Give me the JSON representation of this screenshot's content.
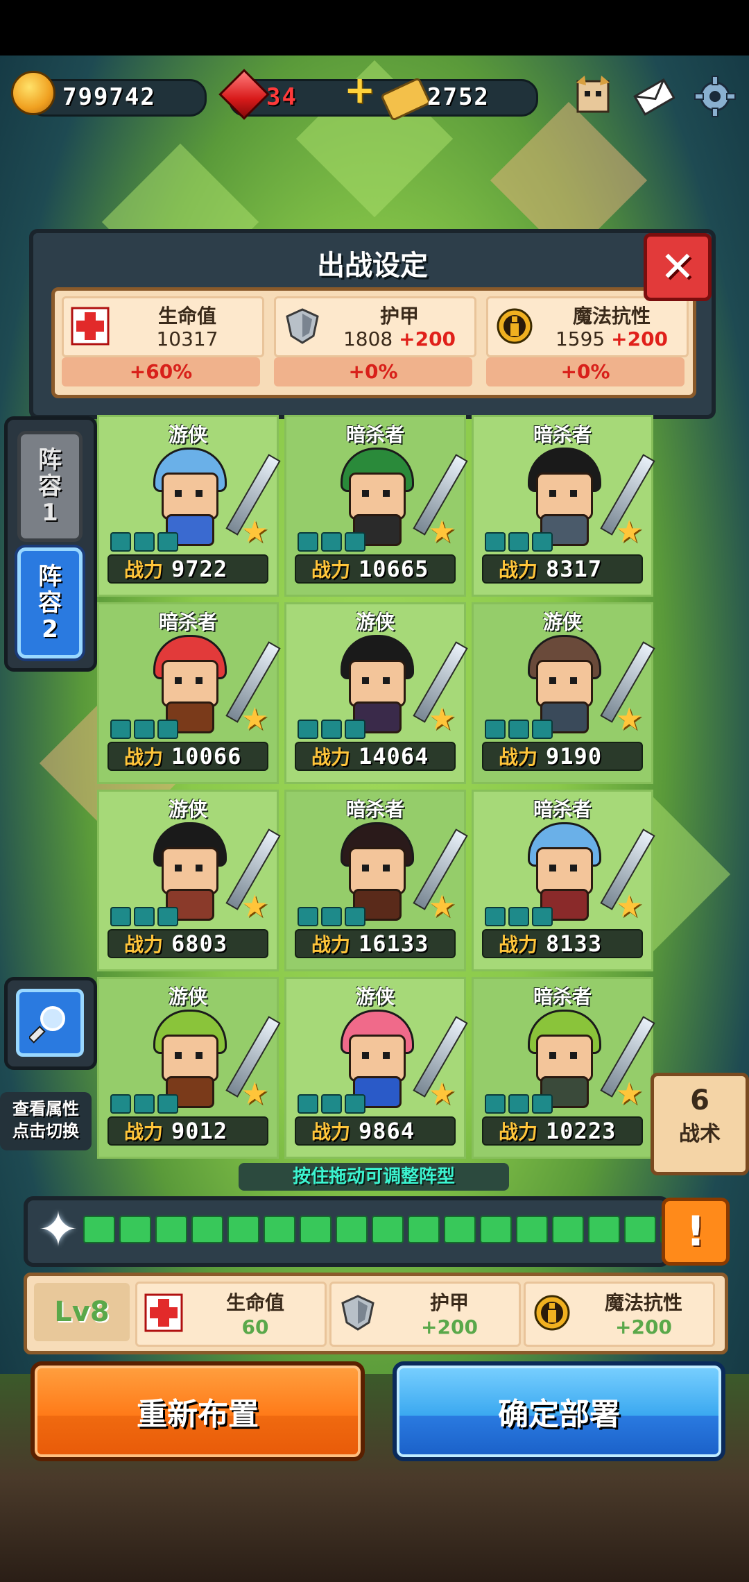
{
  "resources": {
    "gold": "799742",
    "gems": "34",
    "tickets": "2752"
  },
  "panel": {
    "title": "出战设定",
    "stats": [
      {
        "name": "生命值",
        "value": "10317",
        "bonus": "",
        "percent": "+60%"
      },
      {
        "name": "护甲",
        "value": "1808",
        "bonus": "+200",
        "percent": "+0%"
      },
      {
        "name": "魔法抗性",
        "value": "1595",
        "bonus": "+200",
        "percent": "+0%"
      }
    ]
  },
  "lineups": [
    {
      "label_1": "阵",
      "label_2": "容",
      "label_3": "1",
      "selected": false
    },
    {
      "label_1": "阵",
      "label_2": "容",
      "label_3": "2",
      "selected": true
    }
  ],
  "power_label": "战力",
  "heroes": [
    {
      "class": "游侠",
      "power": "9722",
      "hair": "#6ab0e8",
      "body": "#3a6ad0"
    },
    {
      "class": "暗杀者",
      "power": "10665",
      "hair": "#2a8a3a",
      "body": "#2a2a2a"
    },
    {
      "class": "暗杀者",
      "power": "8317",
      "hair": "#1a1a1a",
      "body": "#4a5a6a"
    },
    {
      "class": "暗杀者",
      "power": "10066",
      "hair": "#e23a3a",
      "body": "#7a3a1a"
    },
    {
      "class": "游侠",
      "power": "14064",
      "hair": "#1a1a1a",
      "body": "#3a2a4a"
    },
    {
      "class": "游侠",
      "power": "9190",
      "hair": "#6a4a3a",
      "body": "#3a4a5a"
    },
    {
      "class": "游侠",
      "power": "6803",
      "hair": "#1a1a1a",
      "body": "#8a3a2a"
    },
    {
      "class": "暗杀者",
      "power": "16133",
      "hair": "#2a1a1a",
      "body": "#5a2a1a"
    },
    {
      "class": "暗杀者",
      "power": "8133",
      "hair": "#6ab0e8",
      "body": "#8a2a2a"
    },
    {
      "class": "游侠",
      "power": "9012",
      "hair": "#8ac43a",
      "body": "#7a3a1a"
    },
    {
      "class": "游侠",
      "power": "9864",
      "hair": "#f06a8a",
      "body": "#2a5ac8"
    },
    {
      "class": "暗杀者",
      "power": "10223",
      "hair": "#8ac43a",
      "body": "#3a4a3a"
    }
  ],
  "view_stats": {
    "line1": "查看属性",
    "line2": "点击切换"
  },
  "tactics": {
    "count": "6",
    "label": "战术"
  },
  "hint": "按住拖动可调整阵型",
  "progress": {
    "segments_filled": 17,
    "segments_total": 17
  },
  "level": {
    "label": "Lv8",
    "stats": [
      {
        "name": "生命值",
        "value": "60"
      },
      {
        "name": "护甲",
        "value": "+200"
      },
      {
        "name": "魔法抗性",
        "value": "+200"
      }
    ]
  },
  "buttons": {
    "reset": "重新布置",
    "confirm": "确定部署"
  },
  "icons": {
    "health": "red-cross-icon",
    "armor": "shield-icon",
    "magic_resist": "magic-resist-icon",
    "gold": "coin-icon",
    "gem": "gem-icon",
    "ticket": "ticket-icon",
    "settings": "gear-icon",
    "mail": "mail-icon",
    "avatar": "avatar-icon"
  }
}
